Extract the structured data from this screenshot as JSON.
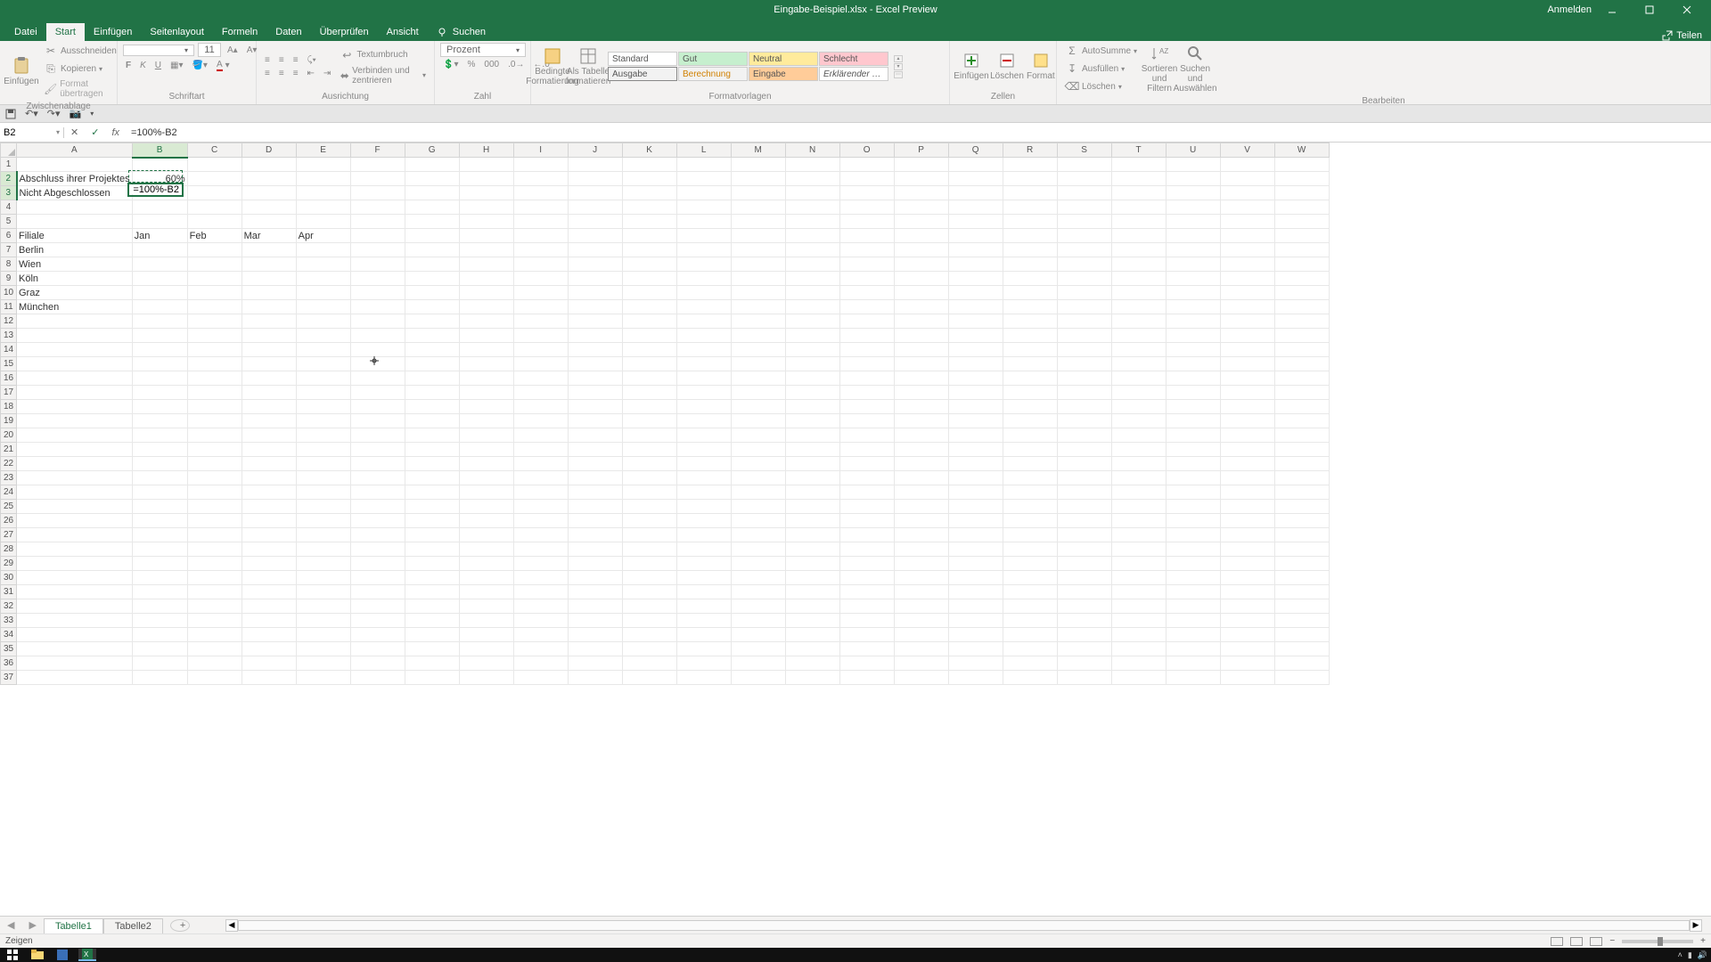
{
  "titlebar": {
    "title": "Eingabe-Beispiel.xlsx - Excel Preview",
    "signin": "Anmelden"
  },
  "tabs": {
    "items": [
      "Datei",
      "Start",
      "Einfügen",
      "Seitenlayout",
      "Formeln",
      "Daten",
      "Überprüfen",
      "Ansicht"
    ],
    "active": 1,
    "search": "Suchen",
    "share": "Teilen"
  },
  "ribbon": {
    "clipboard": {
      "paste": "Einfügen",
      "cut": "Ausschneiden",
      "copy": "Kopieren",
      "format": "Format übertragen",
      "label": "Zwischenablage"
    },
    "font": {
      "size": "11",
      "label": "Schriftart"
    },
    "align": {
      "wrap": "Textumbruch",
      "merge": "Verbinden und zentrieren",
      "label": "Ausrichtung"
    },
    "number": {
      "format": "Prozent",
      "label": "Zahl"
    },
    "styles": {
      "cond": "Bedingte Formatierung",
      "table": "Als Tabelle formatieren",
      "standard": "Standard",
      "gut": "Gut",
      "neutral": "Neutral",
      "schlecht": "Schlecht",
      "ausgabe": "Ausgabe",
      "berechnung": "Berechnung",
      "eingabe": "Eingabe",
      "erklaer": "Erklärender …",
      "label": "Formatvorlagen"
    },
    "cells": {
      "insert": "Einfügen",
      "delete": "Löschen",
      "format": "Format",
      "label": "Zellen"
    },
    "editing": {
      "autosum": "AutoSumme",
      "fill": "Ausfüllen",
      "clear": "Löschen",
      "sort": "Sortieren und Filtern",
      "find": "Suchen und Auswählen",
      "label": "Bearbeiten"
    }
  },
  "formula": {
    "name": "B2",
    "value": "=100%-B2"
  },
  "cols": [
    "A",
    "B",
    "C",
    "D",
    "E",
    "F",
    "G",
    "H",
    "I",
    "J",
    "K",
    "L",
    "M",
    "N",
    "O",
    "P",
    "Q",
    "R",
    "S",
    "T",
    "U",
    "V",
    "W"
  ],
  "activeCol": "B",
  "activeRow1": 2,
  "activeRow2": 3,
  "cells": {
    "a2": "Abschluss ihrer Projektes",
    "b2": "60%",
    "a3": "Nicht Abgeschlossen",
    "b3": "=100%-B2",
    "a6": "Filiale",
    "b6": "Jan",
    "c6": "Feb",
    "d6": "Mar",
    "e6": "Apr",
    "a7": "Berlin",
    "a8": "Wien",
    "a9": "Köln",
    "a10": "Graz",
    "a11": "München"
  },
  "sheet_tabs": {
    "t1": "Tabelle1",
    "t2": "Tabelle2"
  },
  "status": {
    "mode": "Zeigen",
    "zoom": "100%"
  }
}
